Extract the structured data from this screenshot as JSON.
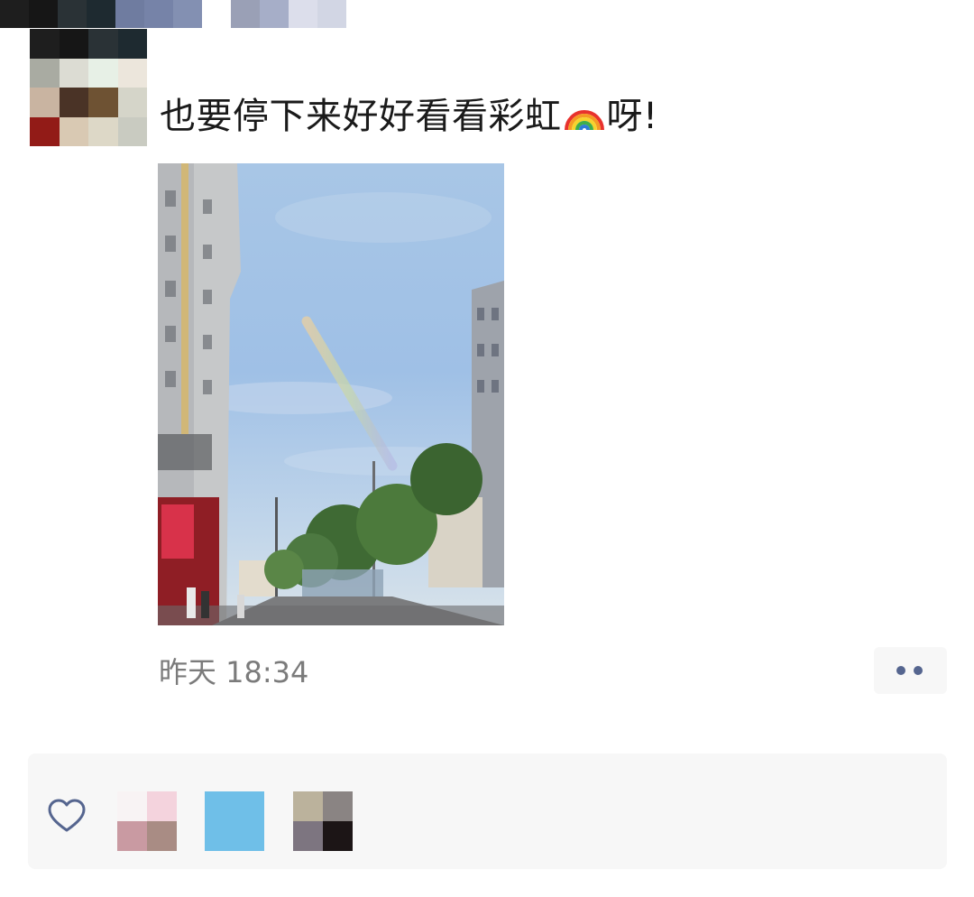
{
  "post": {
    "text_before": "也要停下来好好看看彩虹",
    "emoji": "rainbow-icon",
    "text_after": "呀!",
    "timestamp": "昨天 18:34"
  },
  "colors": {
    "text": "#1a1a1a",
    "timestamp": "#7b7b7b",
    "more_dots": "#55658f",
    "panel_bg": "#f7f7f7",
    "heart": "#55658f"
  },
  "avatar_mosaic": [
    "#1e1e1e",
    "#161616",
    "#2a3236",
    "#1e2a30",
    "#a9aba2",
    "#dcdcd3",
    "#e7f0e6",
    "#ece6dc",
    "#c9b4a1",
    "#4a3326",
    "#6e5233",
    "#d5d5c9",
    "#921b17",
    "#d9c9b3",
    "#ddd8c7",
    "#c9cbc1"
  ],
  "username_mosaic": [
    "#1e1e1e",
    "#161616",
    "#2a3236",
    "#1e2a30",
    "#6f7ca0",
    "#7683a8",
    "#8390b2",
    "",
    "#9aa0b6",
    "#a6aec8",
    "#dcdeeb",
    "#d2d6e4"
  ],
  "likers": [
    {
      "cells": [
        "#f8f3f4",
        "#f4d3dd",
        "#c99aa2",
        "#a98c84"
      ]
    },
    {
      "cells": [
        "#6fbfe8",
        "#6fbfe8",
        "#6fbfe8",
        "#6fbfe8"
      ]
    },
    {
      "cells": [
        "#bbb29c",
        "#8a8483",
        "#7d7580",
        "#1c1516"
      ]
    }
  ],
  "icons": {
    "more": "more-dots-icon",
    "like": "heart-icon"
  }
}
